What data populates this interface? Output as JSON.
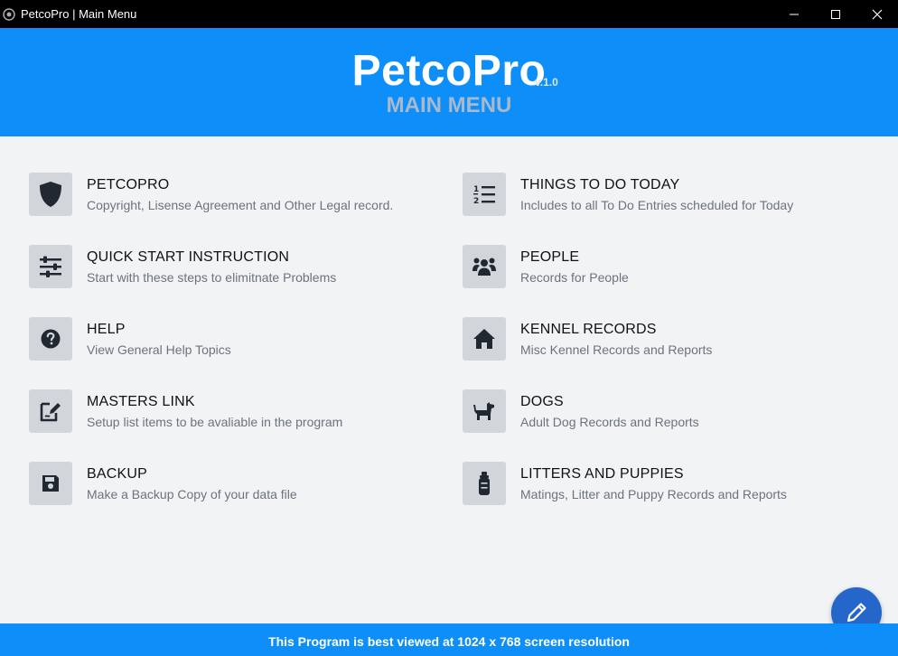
{
  "window": {
    "title": "PetcoPro | Main Menu"
  },
  "header": {
    "app_name": "PetcoPro",
    "version": "v.1.0",
    "subtitle": "MAIN MENU"
  },
  "menu": {
    "left": [
      {
        "label": "PETCOPRO",
        "description": "Copyright, Lisense Agreement and Other Legal record.",
        "icon": "shield-icon"
      },
      {
        "label": "QUICK START INSTRUCTION",
        "description": "Start with these steps to elimitnate Problems",
        "icon": "sliders-icon"
      },
      {
        "label": "HELP",
        "description": "View General Help Topics",
        "icon": "question-circle-icon"
      },
      {
        "label": "MASTERS LINK",
        "description": "Setup list items to be avaliable in the program",
        "icon": "edit-document-icon"
      },
      {
        "label": "BACKUP",
        "description": "Make a Backup Copy of your data file",
        "icon": "floppy-disk-icon"
      }
    ],
    "right": [
      {
        "label": "THINGS TO DO TODAY",
        "description": "Includes to all To Do Entries scheduled for Today",
        "icon": "ordered-list-icon"
      },
      {
        "label": "PEOPLE",
        "description": "Records for People",
        "icon": "people-group-icon"
      },
      {
        "label": "KENNEL RECORDS",
        "description": "Misc Kennel Records and Reports",
        "icon": "house-icon"
      },
      {
        "label": "DOGS",
        "description": "Adult Dog Records and Reports",
        "icon": "dog-icon"
      },
      {
        "label": "LITTERS AND PUPPIES",
        "description": "Matings, Litter and Puppy Records and Reports",
        "icon": "baby-bottle-icon"
      }
    ]
  },
  "footer": {
    "text": "This Program is best viewed at 1024 x 768 screen resolution"
  },
  "fab": {
    "icon": "pencil-icon"
  },
  "colors": {
    "accent": "#0d8ef8",
    "fab": "#2466c9",
    "background": "#f2f3f5",
    "icon_box": "#d2d5da"
  }
}
